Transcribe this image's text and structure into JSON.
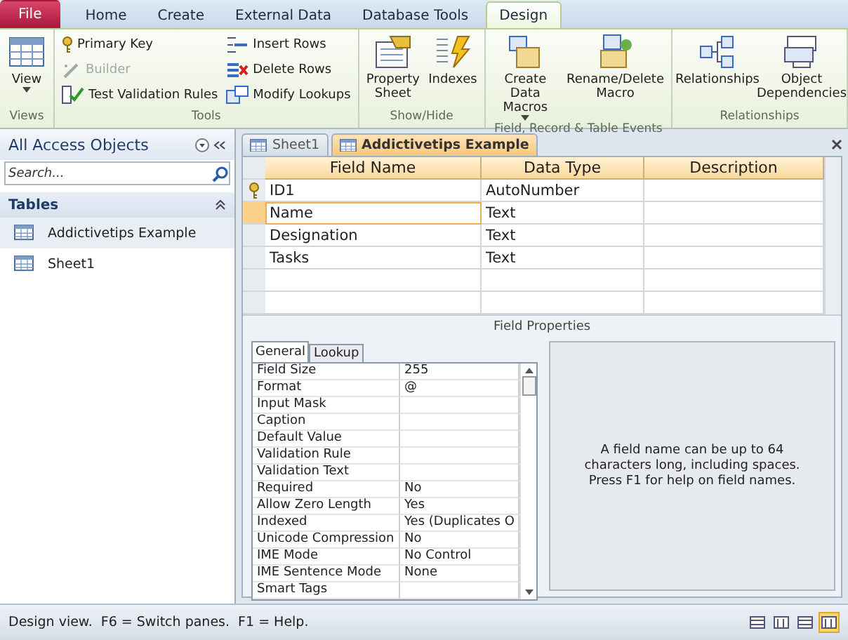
{
  "ribbon": {
    "tabs": [
      {
        "label": "File",
        "kind": "file",
        "selected": false
      },
      {
        "label": "Home",
        "kind": "tab",
        "selected": false
      },
      {
        "label": "Create",
        "kind": "tab",
        "selected": false
      },
      {
        "label": "External Data",
        "kind": "tab",
        "selected": false
      },
      {
        "label": "Database Tools",
        "kind": "tab",
        "selected": false
      },
      {
        "label": "Design",
        "kind": "tab",
        "selected": true
      }
    ],
    "groups": [
      {
        "label": "Views",
        "commands": [
          {
            "kind": "large",
            "label": "View",
            "dropdown": true
          }
        ]
      },
      {
        "label": "Tools",
        "commands": [
          {
            "kind": "small",
            "label": "Primary Key",
            "disabled": false
          },
          {
            "kind": "small",
            "label": "Builder",
            "disabled": true
          },
          {
            "kind": "small",
            "label": "Test Validation Rules",
            "disabled": false
          },
          {
            "kind": "small",
            "label": "Insert Rows",
            "disabled": false
          },
          {
            "kind": "small",
            "label": "Delete Rows",
            "disabled": false
          },
          {
            "kind": "small",
            "label": "Modify Lookups",
            "disabled": false
          }
        ]
      },
      {
        "label": "Show/Hide",
        "commands": [
          {
            "kind": "large",
            "label": "Property Sheet",
            "dropdown": false
          },
          {
            "kind": "large",
            "label": "Indexes",
            "dropdown": false
          }
        ]
      },
      {
        "label": "Field, Record & Table Events",
        "commands": [
          {
            "kind": "large",
            "label": "Create Data Macros",
            "dropdown": true
          },
          {
            "kind": "large",
            "label": "Rename/Delete Macro",
            "dropdown": false
          }
        ]
      },
      {
        "label": "Relationships",
        "commands": [
          {
            "kind": "large",
            "label": "Relationships",
            "dropdown": false
          },
          {
            "kind": "large",
            "label": "Object Dependencies",
            "dropdown": false
          }
        ]
      }
    ]
  },
  "nav": {
    "title": "All Access Objects",
    "search": {
      "placeholder": "Search..."
    },
    "group": "Tables",
    "items": [
      {
        "label": "Addictivetips Example",
        "selected": true
      },
      {
        "label": "Sheet1",
        "selected": false
      }
    ]
  },
  "doc_tabs": [
    {
      "label": "Sheet1",
      "selected": false
    },
    {
      "label": "Addictivetips Example",
      "selected": true
    }
  ],
  "design_grid": {
    "columns": [
      "Field Name",
      "Data Type",
      "Description"
    ],
    "rows": [
      {
        "field_name": "ID1",
        "data_type": "AutoNumber",
        "primary_key": true,
        "selected": false
      },
      {
        "field_name": "Name",
        "data_type": "Text",
        "primary_key": false,
        "selected": true
      },
      {
        "field_name": "Designation",
        "data_type": "Text",
        "primary_key": false,
        "selected": false
      },
      {
        "field_name": "Tasks",
        "data_type": "Text",
        "primary_key": false,
        "selected": false
      }
    ]
  },
  "field_properties": {
    "title": "Field Properties",
    "tabs": [
      {
        "label": "General",
        "selected": true
      },
      {
        "label": "Lookup",
        "selected": false
      }
    ],
    "properties": [
      {
        "label": "Field Size",
        "value": "255"
      },
      {
        "label": "Format",
        "value": "@"
      },
      {
        "label": "Input Mask"
      },
      {
        "label": "Caption"
      },
      {
        "label": "Default Value"
      },
      {
        "label": "Validation Rule"
      },
      {
        "label": "Validation Text"
      },
      {
        "label": "Required",
        "value": "No"
      },
      {
        "label": "Allow Zero Length",
        "value": "Yes"
      },
      {
        "label": "Indexed",
        "value": "Yes (Duplicates O"
      },
      {
        "label": "Unicode Compression",
        "value": "No"
      },
      {
        "label": "IME Mode",
        "value": "No Control"
      },
      {
        "label": "IME Sentence Mode",
        "value": "None"
      },
      {
        "label": "Smart Tags"
      }
    ],
    "help": "A field name can be up to 64 characters long, including spaces. Press F1 for help on field names."
  },
  "status_bar": {
    "text": "Design view.  F6 = Switch panes.  F1 = Help.",
    "views": [
      {
        "selected": false
      },
      {
        "selected": false
      },
      {
        "selected": false
      },
      {
        "selected": true
      }
    ]
  }
}
